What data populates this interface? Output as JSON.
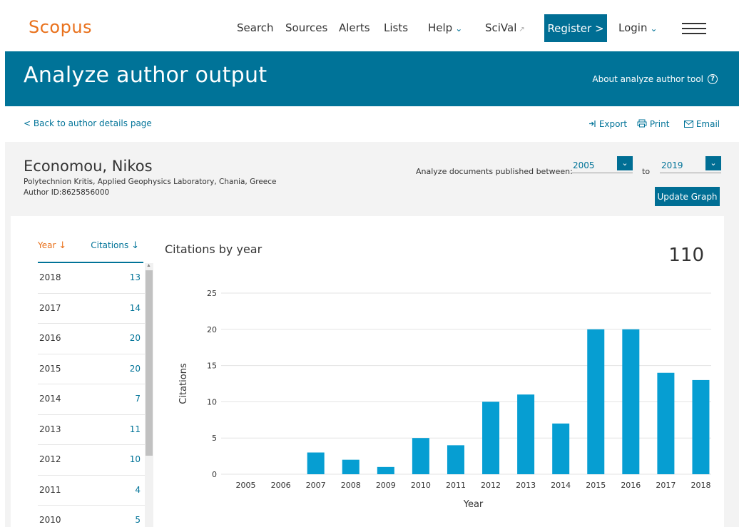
{
  "nav": {
    "logo": "Scopus",
    "links": [
      "Search",
      "Sources",
      "Alerts",
      "Lists",
      "Help",
      "SciVal"
    ],
    "register": "Register >",
    "login": "Login"
  },
  "banner": {
    "title": "Analyze author output",
    "about": "About analyze author tool"
  },
  "subbar": {
    "back": "< Back to author details page",
    "export": "Export",
    "print": "Print",
    "email": "Email"
  },
  "author": {
    "name": "Economou, Nikos",
    "affiliation": "Polytechnion Kritis, Applied Geophysics Laboratory, Chania, Greece",
    "author_id": "Author ID:8625856000"
  },
  "range": {
    "label": "Analyze documents published between:",
    "from": "2005",
    "to_label": "to",
    "to": "2019",
    "update": "Update Graph"
  },
  "table": {
    "year_header": "Year",
    "citations_header": "Citations",
    "rows": [
      {
        "year": "2018",
        "citations": "13"
      },
      {
        "year": "2017",
        "citations": "14"
      },
      {
        "year": "2016",
        "citations": "20"
      },
      {
        "year": "2015",
        "citations": "20"
      },
      {
        "year": "2014",
        "citations": "7"
      },
      {
        "year": "2013",
        "citations": "11"
      },
      {
        "year": "2012",
        "citations": "10"
      },
      {
        "year": "2011",
        "citations": "4"
      },
      {
        "year": "2010",
        "citations": "5"
      }
    ]
  },
  "summary": {
    "title": "Citations by year",
    "total": "110"
  },
  "colors": {
    "brand_orange": "#e9711c",
    "primary_blue": "#007398",
    "bar_blue": "#069ed2"
  },
  "chart_data": {
    "type": "bar",
    "categories": [
      "2005",
      "2006",
      "2007",
      "2008",
      "2009",
      "2010",
      "2011",
      "2012",
      "2013",
      "2014",
      "2015",
      "2016",
      "2017",
      "2018"
    ],
    "values": [
      0,
      0,
      3,
      2,
      1,
      5,
      4,
      10,
      11,
      7,
      20,
      20,
      14,
      13
    ],
    "xlabel": "Year",
    "ylabel": "Citations",
    "ylim": [
      0,
      25
    ],
    "yticks": [
      "0",
      "5",
      "10",
      "15",
      "20",
      "25"
    ],
    "grid": true
  }
}
